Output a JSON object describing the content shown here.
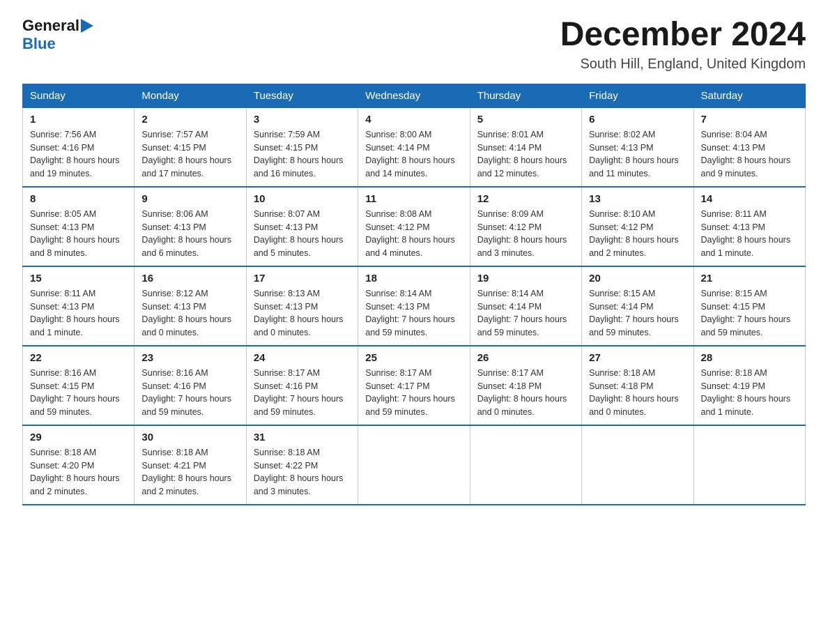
{
  "header": {
    "logo": {
      "general": "General",
      "blue": "Blue"
    },
    "title": "December 2024",
    "location": "South Hill, England, United Kingdom"
  },
  "calendar": {
    "days_of_week": [
      "Sunday",
      "Monday",
      "Tuesday",
      "Wednesday",
      "Thursday",
      "Friday",
      "Saturday"
    ],
    "weeks": [
      [
        {
          "day": "1",
          "sunrise": "7:56 AM",
          "sunset": "4:16 PM",
          "daylight": "8 hours and 19 minutes."
        },
        {
          "day": "2",
          "sunrise": "7:57 AM",
          "sunset": "4:15 PM",
          "daylight": "8 hours and 17 minutes."
        },
        {
          "day": "3",
          "sunrise": "7:59 AM",
          "sunset": "4:15 PM",
          "daylight": "8 hours and 16 minutes."
        },
        {
          "day": "4",
          "sunrise": "8:00 AM",
          "sunset": "4:14 PM",
          "daylight": "8 hours and 14 minutes."
        },
        {
          "day": "5",
          "sunrise": "8:01 AM",
          "sunset": "4:14 PM",
          "daylight": "8 hours and 12 minutes."
        },
        {
          "day": "6",
          "sunrise": "8:02 AM",
          "sunset": "4:13 PM",
          "daylight": "8 hours and 11 minutes."
        },
        {
          "day": "7",
          "sunrise": "8:04 AM",
          "sunset": "4:13 PM",
          "daylight": "8 hours and 9 minutes."
        }
      ],
      [
        {
          "day": "8",
          "sunrise": "8:05 AM",
          "sunset": "4:13 PM",
          "daylight": "8 hours and 8 minutes."
        },
        {
          "day": "9",
          "sunrise": "8:06 AM",
          "sunset": "4:13 PM",
          "daylight": "8 hours and 6 minutes."
        },
        {
          "day": "10",
          "sunrise": "8:07 AM",
          "sunset": "4:13 PM",
          "daylight": "8 hours and 5 minutes."
        },
        {
          "day": "11",
          "sunrise": "8:08 AM",
          "sunset": "4:12 PM",
          "daylight": "8 hours and 4 minutes."
        },
        {
          "day": "12",
          "sunrise": "8:09 AM",
          "sunset": "4:12 PM",
          "daylight": "8 hours and 3 minutes."
        },
        {
          "day": "13",
          "sunrise": "8:10 AM",
          "sunset": "4:12 PM",
          "daylight": "8 hours and 2 minutes."
        },
        {
          "day": "14",
          "sunrise": "8:11 AM",
          "sunset": "4:13 PM",
          "daylight": "8 hours and 1 minute."
        }
      ],
      [
        {
          "day": "15",
          "sunrise": "8:11 AM",
          "sunset": "4:13 PM",
          "daylight": "8 hours and 1 minute."
        },
        {
          "day": "16",
          "sunrise": "8:12 AM",
          "sunset": "4:13 PM",
          "daylight": "8 hours and 0 minutes."
        },
        {
          "day": "17",
          "sunrise": "8:13 AM",
          "sunset": "4:13 PM",
          "daylight": "8 hours and 0 minutes."
        },
        {
          "day": "18",
          "sunrise": "8:14 AM",
          "sunset": "4:13 PM",
          "daylight": "7 hours and 59 minutes."
        },
        {
          "day": "19",
          "sunrise": "8:14 AM",
          "sunset": "4:14 PM",
          "daylight": "7 hours and 59 minutes."
        },
        {
          "day": "20",
          "sunrise": "8:15 AM",
          "sunset": "4:14 PM",
          "daylight": "7 hours and 59 minutes."
        },
        {
          "day": "21",
          "sunrise": "8:15 AM",
          "sunset": "4:15 PM",
          "daylight": "7 hours and 59 minutes."
        }
      ],
      [
        {
          "day": "22",
          "sunrise": "8:16 AM",
          "sunset": "4:15 PM",
          "daylight": "7 hours and 59 minutes."
        },
        {
          "day": "23",
          "sunrise": "8:16 AM",
          "sunset": "4:16 PM",
          "daylight": "7 hours and 59 minutes."
        },
        {
          "day": "24",
          "sunrise": "8:17 AM",
          "sunset": "4:16 PM",
          "daylight": "7 hours and 59 minutes."
        },
        {
          "day": "25",
          "sunrise": "8:17 AM",
          "sunset": "4:17 PM",
          "daylight": "7 hours and 59 minutes."
        },
        {
          "day": "26",
          "sunrise": "8:17 AM",
          "sunset": "4:18 PM",
          "daylight": "8 hours and 0 minutes."
        },
        {
          "day": "27",
          "sunrise": "8:18 AM",
          "sunset": "4:18 PM",
          "daylight": "8 hours and 0 minutes."
        },
        {
          "day": "28",
          "sunrise": "8:18 AM",
          "sunset": "4:19 PM",
          "daylight": "8 hours and 1 minute."
        }
      ],
      [
        {
          "day": "29",
          "sunrise": "8:18 AM",
          "sunset": "4:20 PM",
          "daylight": "8 hours and 2 minutes."
        },
        {
          "day": "30",
          "sunrise": "8:18 AM",
          "sunset": "4:21 PM",
          "daylight": "8 hours and 2 minutes."
        },
        {
          "day": "31",
          "sunrise": "8:18 AM",
          "sunset": "4:22 PM",
          "daylight": "8 hours and 3 minutes."
        },
        null,
        null,
        null,
        null
      ]
    ],
    "labels": {
      "sunrise": "Sunrise:",
      "sunset": "Sunset:",
      "daylight": "Daylight:"
    }
  }
}
